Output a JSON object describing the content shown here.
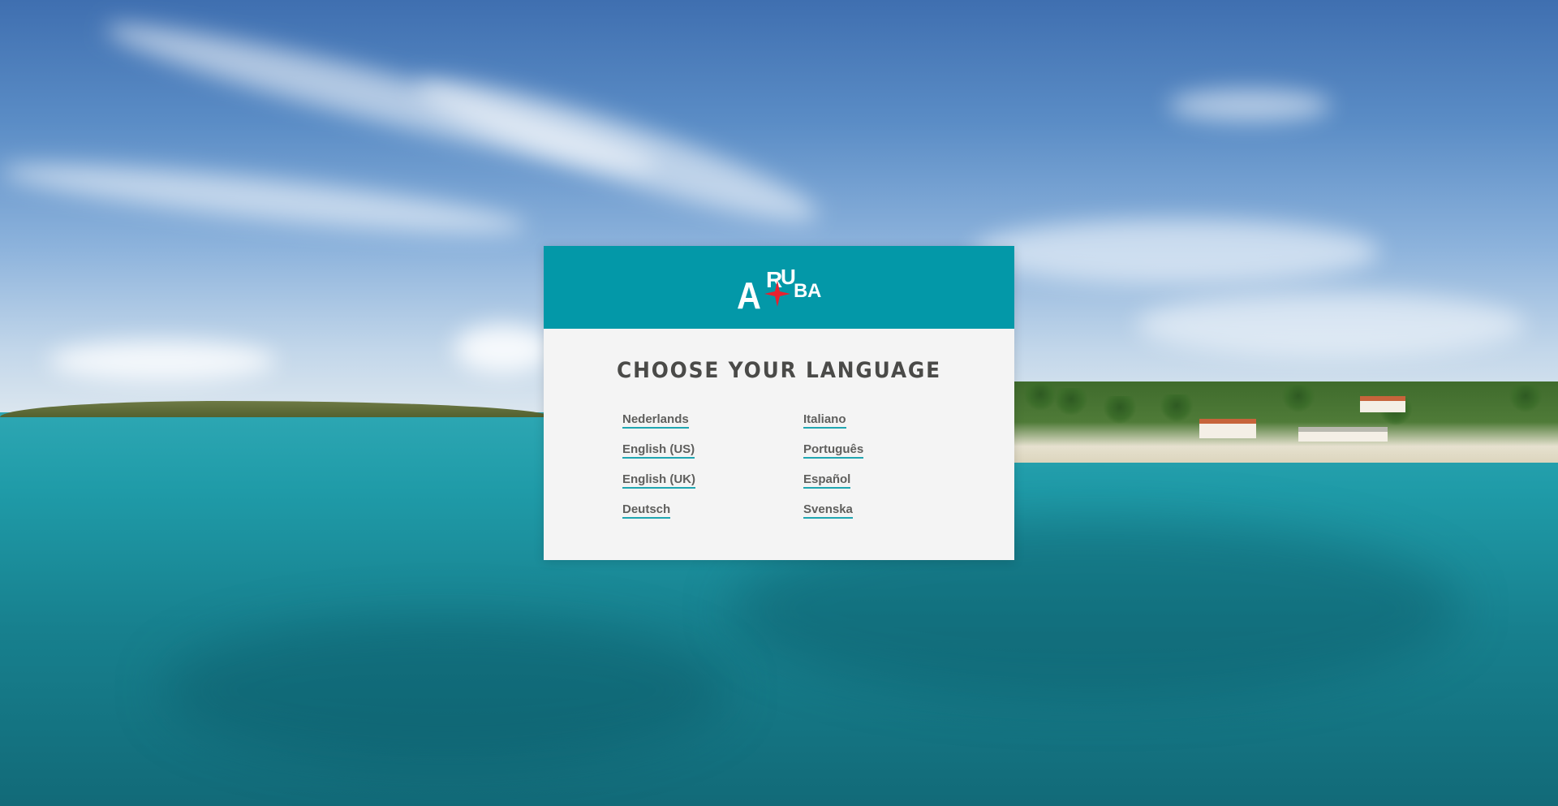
{
  "page": {
    "background": "aruba-coastline-photo"
  },
  "header": {
    "logo_text": "ARUBA",
    "logo_color": "#ffffff",
    "logo_star_color": "#e8202f",
    "header_color": "#0398a8"
  },
  "modal": {
    "title": "CHOOSE YOUR LANGUAGE",
    "languages": [
      "Nederlands",
      "Italiano",
      "English (US)",
      "Português",
      "English (UK)",
      "Español",
      "Deutsch",
      "Svenska"
    ],
    "link_underline_color": "#1fa6b1"
  }
}
